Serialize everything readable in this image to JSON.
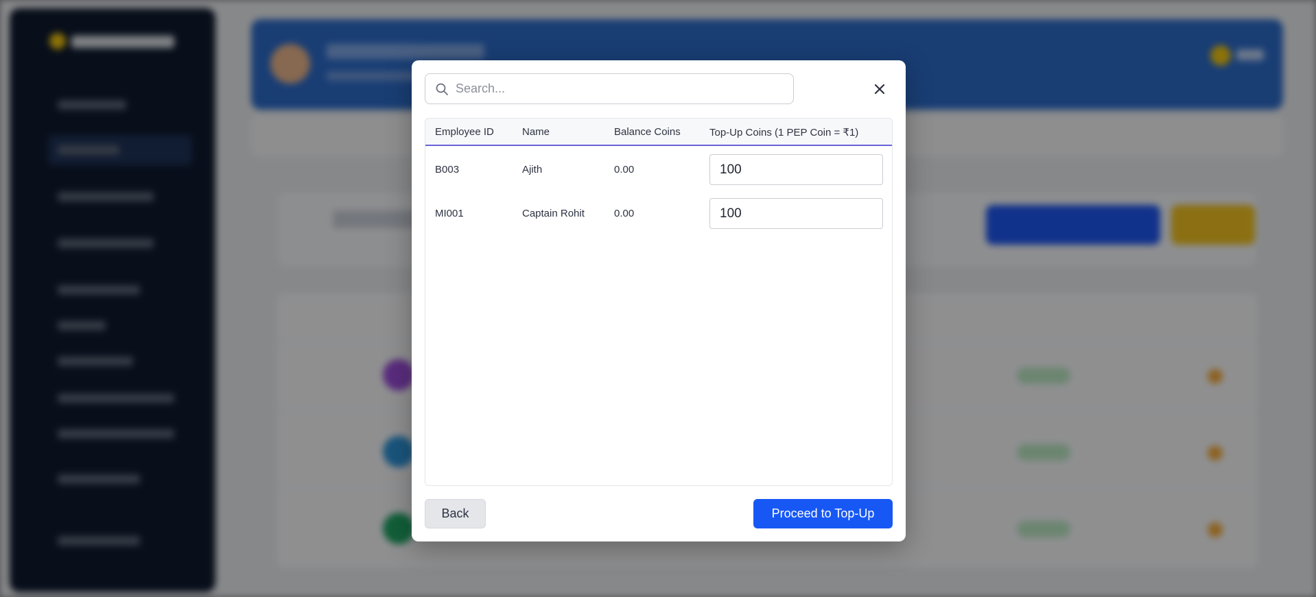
{
  "modal": {
    "search": {
      "placeholder": "Search..."
    },
    "close_icon": "close-icon",
    "table": {
      "headers": [
        "Employee ID",
        "Name",
        "Balance Coins",
        "Top-Up Coins (1 PEP Coin = ₹1)"
      ],
      "rows": [
        {
          "employee_id": "B003",
          "name": "Ajith",
          "balance": "0.00",
          "topup": "100"
        },
        {
          "employee_id": "MI001",
          "name": "Captain Rohit",
          "balance": "0.00",
          "topup": "100"
        }
      ]
    },
    "back_label": "Back",
    "proceed_label": "Proceed to Top-Up"
  },
  "colors": {
    "primary": "#1758f5",
    "header_underline": "#6a63d8",
    "sidebar": "#0f1a2e",
    "banner": "#2c6bc9"
  }
}
